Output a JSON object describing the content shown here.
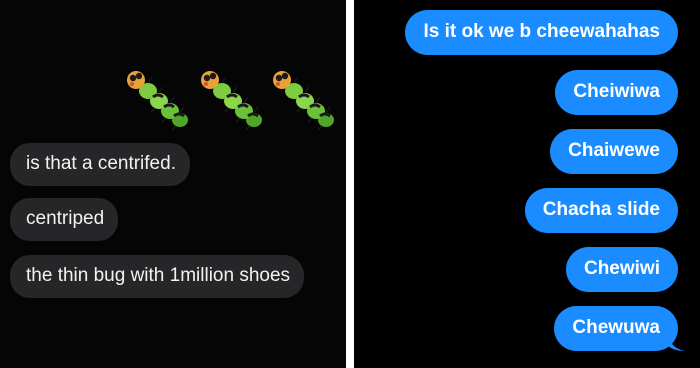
{
  "left_panel": {
    "reaction_icons": [
      "caterpillar-icon",
      "caterpillar-icon",
      "caterpillar-icon"
    ],
    "messages": [
      "is that a centrifed.",
      "centriped",
      "the thin bug with 1million shoes"
    ]
  },
  "right_panel": {
    "messages": [
      "Is it ok we b cheewahahas",
      "Cheiwiwa",
      "Chaiwewe",
      "Chacha slide",
      "Chewiwi",
      "Chewuwa"
    ]
  },
  "colors": {
    "incoming_bubble": "#262628",
    "outgoing_bubble": "#1a8cff",
    "background": "#000000",
    "divider": "#ffffff"
  }
}
